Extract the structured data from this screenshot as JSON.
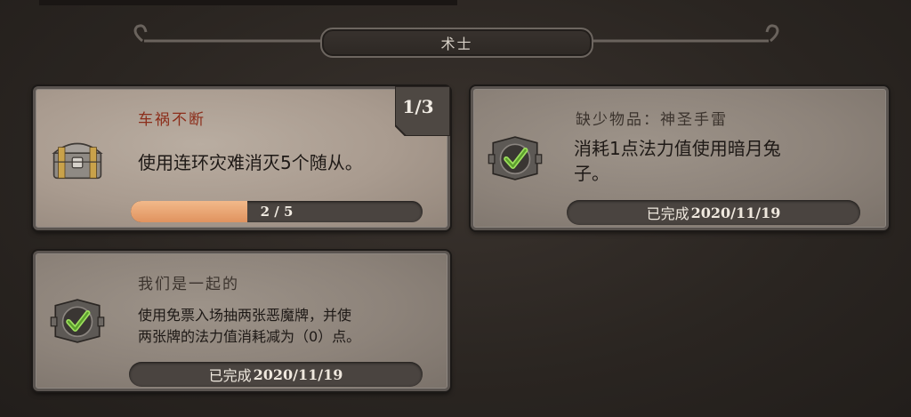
{
  "header": {
    "title": "术士"
  },
  "quests": [
    {
      "name": "车祸不断",
      "description": "使用连环灾难消灭5个随从。",
      "progress_text": "2 / 5",
      "progress_fraction": 0.4,
      "counter": "1/3",
      "icon": "treasure-chest-icon"
    },
    {
      "name": "缺少物品：神圣手雷",
      "description_line1": "消耗1点法力值使用暗月兔",
      "description_line2": "子。",
      "status_label": "已完成",
      "date": "2020/11/19",
      "icon": "checkmark-chest-icon"
    },
    {
      "name": "我们是一起的",
      "description_line1": "使用免票入场抽两张恶魔牌，并使",
      "description_line2": "两张牌的法力值消耗减为（0）点。",
      "status_label": "已完成",
      "date": "2020/11/19",
      "icon": "checkmark-chest-icon"
    }
  ],
  "colors": {
    "active_title": "#8c2e1b",
    "progress_fill": "#e0935f",
    "check_green": "#7fc24a"
  }
}
